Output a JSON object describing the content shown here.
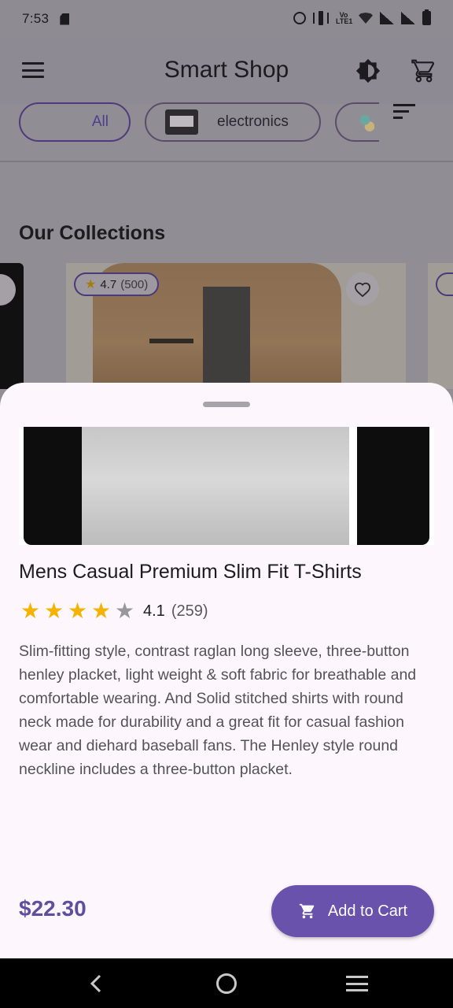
{
  "status_bar": {
    "time": "7:53",
    "volte": "Vo LTE1"
  },
  "app_bar": {
    "title": "Smart Shop"
  },
  "categories": {
    "all": "All",
    "electronics": "electronics"
  },
  "collections": {
    "title": "Our Collections",
    "featured_rating": "4.7",
    "featured_count": "(500)"
  },
  "product": {
    "title": "Mens Casual Premium Slim Fit T-Shirts",
    "rating": "4.1",
    "rating_stars": 4.1,
    "rating_count": "(259)",
    "description": "Slim-fitting style, contrast raglan long sleeve, three-button henley placket, light weight & soft fabric for breathable and comfortable wearing. And Solid stitched shirts with round neck made for durability and a great fit for casual fashion wear and diehard baseball fans. The Henley style round neckline includes a three-button placket.",
    "price": "$22.30",
    "add_to_cart_label": "Add to Cart"
  },
  "colors": {
    "primary": "#6852ab",
    "star": "#f5b301",
    "sheet_bg": "#fdf6fd"
  },
  "icons": [
    "menu-icon",
    "brightness-icon",
    "cart-icon",
    "sort-icon",
    "heart-icon",
    "star-icon",
    "back-icon",
    "home-icon",
    "recents-icon"
  ]
}
